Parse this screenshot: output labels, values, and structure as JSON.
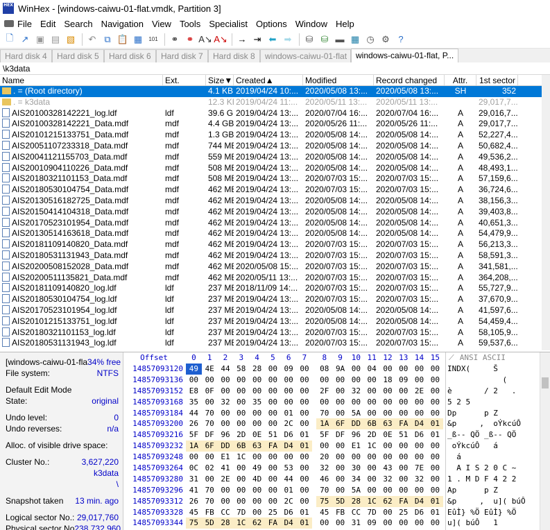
{
  "window": {
    "title": "WinHex - [windows-caiwu-01-flat.vmdk, Partition 3]",
    "icon_label": "HEX"
  },
  "menu": [
    "File",
    "Edit",
    "Search",
    "Navigation",
    "View",
    "Tools",
    "Specialist",
    "Options",
    "Window",
    "Help"
  ],
  "toolbar": {
    "icons": [
      "new-file-icon",
      "open-icon",
      "save-icon",
      "print-icon",
      "properties-icon",
      "undo-icon",
      "copy-icon",
      "paste-icon",
      "paste-hex-icon",
      "write-icon",
      "binoculars-icon",
      "find-hex-icon",
      "replace-icon",
      "replace-hex-icon",
      "goto-offset-icon",
      "goto-sector-icon",
      "back-icon",
      "forward-icon",
      "disk-icon",
      "open-disk-icon",
      "ram-icon",
      "calculator-icon",
      "clock-icon",
      "options-icon",
      "help-icon"
    ]
  },
  "tabs": [
    "Hard disk 4",
    "Hard disk 5",
    "Hard disk 6",
    "Hard disk 7",
    "Hard disk 8",
    "windows-caiwu-01-flat",
    "windows-caiwu-01-flat, P..."
  ],
  "path": "\\k3data",
  "columns": [
    "Name",
    "Ext.",
    "Size▼",
    "Created▲",
    "Modified",
    "Record changed",
    "Attr.",
    "1st sector"
  ],
  "files": [
    {
      "name": ". = (Root directory)",
      "ext": "",
      "size": "4.1 KB",
      "created": "2019/04/24 10:...",
      "modified": "2020/05/08 13:...",
      "rec": "2020/05/08 13:...",
      "attr": "SH",
      "sector": "352",
      "type": "folder",
      "style": "sel"
    },
    {
      "name": ". = k3data",
      "ext": "",
      "size": "12.3 KB",
      "created": "2019/04/24 11:...",
      "modified": "2020/05/11 13:...",
      "rec": "2020/05/11 13:...",
      "attr": "",
      "sector": "29,017,7...",
      "type": "folder",
      "style": "gray"
    },
    {
      "name": "AIS20100328142221_log.ldf",
      "ext": "ldf",
      "size": "39.6 GB",
      "created": "2019/04/24 13:...",
      "modified": "2020/07/04 16:...",
      "rec": "2020/07/04 16:...",
      "attr": "A",
      "sector": "29,016,7...",
      "type": "file",
      "style": ""
    },
    {
      "name": "AIS20100328142221_Data.mdf",
      "ext": "mdf",
      "size": "4.4 GB",
      "created": "2019/04/24 13:...",
      "modified": "2020/05/26 11:...",
      "rec": "2020/05/26 11:...",
      "attr": "A",
      "sector": "29,017,7...",
      "type": "file",
      "style": ""
    },
    {
      "name": "AIS20101215133751_Data.mdf",
      "ext": "mdf",
      "size": "1.3 GB",
      "created": "2019/04/24 13:...",
      "modified": "2020/05/08 14:...",
      "rec": "2020/05/08 14:...",
      "attr": "A",
      "sector": "52,227,4...",
      "type": "file",
      "style": ""
    },
    {
      "name": "AIS20051107233318_Data.mdf",
      "ext": "mdf",
      "size": "744 MB",
      "created": "2019/04/24 13:...",
      "modified": "2020/05/08 14:...",
      "rec": "2020/05/08 14:...",
      "attr": "A",
      "sector": "50,682,4...",
      "type": "file",
      "style": ""
    },
    {
      "name": "AIS20041121155703_Data.mdf",
      "ext": "mdf",
      "size": "559 MB",
      "created": "2019/04/24 13:...",
      "modified": "2020/05/08 14:...",
      "rec": "2020/05/08 14:...",
      "attr": "A",
      "sector": "49,536,2...",
      "type": "file",
      "style": ""
    },
    {
      "name": "AIS20010904110226_Data.mdf",
      "ext": "mdf",
      "size": "508 MB",
      "created": "2019/04/24 13:...",
      "modified": "2020/05/08 14:...",
      "rec": "2020/05/08 14:...",
      "attr": "A",
      "sector": "48,493,1...",
      "type": "file",
      "style": ""
    },
    {
      "name": "AIS20180321101153_Data.mdf",
      "ext": "mdf",
      "size": "508 MB",
      "created": "2019/04/24 13:...",
      "modified": "2020/07/03 15:...",
      "rec": "2020/07/03 15:...",
      "attr": "A",
      "sector": "57,159,6...",
      "type": "file",
      "style": ""
    },
    {
      "name": "AIS20180530104754_Data.mdf",
      "ext": "mdf",
      "size": "462 MB",
      "created": "2019/04/24 13:...",
      "modified": "2020/07/03 15:...",
      "rec": "2020/07/03 15:...",
      "attr": "A",
      "sector": "36,724,6...",
      "type": "file",
      "style": ""
    },
    {
      "name": "AIS20130516182725_Data.mdf",
      "ext": "mdf",
      "size": "462 MB",
      "created": "2019/04/24 13:...",
      "modified": "2020/05/08 14:...",
      "rec": "2020/05/08 14:...",
      "attr": "A",
      "sector": "38,156,3...",
      "type": "file",
      "style": ""
    },
    {
      "name": "AIS20150414104318_Data.mdf",
      "ext": "mdf",
      "size": "462 MB",
      "created": "2019/04/24 13:...",
      "modified": "2020/05/08 14:...",
      "rec": "2020/05/08 14:...",
      "attr": "A",
      "sector": "39,403,8...",
      "type": "file",
      "style": ""
    },
    {
      "name": "AIS20170523101954_Data.mdf",
      "ext": "mdf",
      "size": "462 MB",
      "created": "2019/04/24 13:...",
      "modified": "2020/05/08 14:...",
      "rec": "2020/05/08 14:...",
      "attr": "A",
      "sector": "40,651,3...",
      "type": "file",
      "style": ""
    },
    {
      "name": "AIS20130514163618_Data.mdf",
      "ext": "mdf",
      "size": "462 MB",
      "created": "2019/04/24 13:...",
      "modified": "2020/05/08 14:...",
      "rec": "2020/05/08 14:...",
      "attr": "A",
      "sector": "54,479,9...",
      "type": "file",
      "style": ""
    },
    {
      "name": "AIS20181109140820_Data.mdf",
      "ext": "mdf",
      "size": "462 MB",
      "created": "2019/04/24 13:...",
      "modified": "2020/07/03 15:...",
      "rec": "2020/07/03 15:...",
      "attr": "A",
      "sector": "56,213,3...",
      "type": "file",
      "style": ""
    },
    {
      "name": "AIS20180531131943_Data.mdf",
      "ext": "mdf",
      "size": "462 MB",
      "created": "2019/04/24 13:...",
      "modified": "2020/07/03 15:...",
      "rec": "2020/07/03 15:...",
      "attr": "A",
      "sector": "58,591,3...",
      "type": "file",
      "style": ""
    },
    {
      "name": "AIS20200508152028_Data.mdf",
      "ext": "mdf",
      "size": "462 MB",
      "created": "2020/05/08 15:...",
      "modified": "2020/07/03 15:...",
      "rec": "2020/07/03 15:...",
      "attr": "A",
      "sector": "341,581,...",
      "type": "file",
      "style": ""
    },
    {
      "name": "AIS20200511135821_Data.mdf",
      "ext": "mdf",
      "size": "462 MB",
      "created": "2020/05/11 13:...",
      "modified": "2020/07/03 15:...",
      "rec": "2020/07/03 15:...",
      "attr": "A",
      "sector": "364,208,...",
      "type": "file",
      "style": ""
    },
    {
      "name": "AIS20181109140820_log.ldf",
      "ext": "ldf",
      "size": "237 MB",
      "created": "2018/11/09 14:...",
      "modified": "2020/07/03 15:...",
      "rec": "2020/07/03 15:...",
      "attr": "A",
      "sector": "55,727,9...",
      "type": "file",
      "style": ""
    },
    {
      "name": "AIS20180530104754_log.ldf",
      "ext": "ldf",
      "size": "237 MB",
      "created": "2019/04/24 13:...",
      "modified": "2020/07/03 15:...",
      "rec": "2020/07/03 15:...",
      "attr": "A",
      "sector": "37,670,9...",
      "type": "file",
      "style": ""
    },
    {
      "name": "AIS20170523101954_log.ldf",
      "ext": "ldf",
      "size": "237 MB",
      "created": "2019/04/24 13:...",
      "modified": "2020/05/08 14:...",
      "rec": "2020/05/08 14:...",
      "attr": "A",
      "sector": "41,597,6...",
      "type": "file",
      "style": ""
    },
    {
      "name": "AIS20101215133751_log.ldf",
      "ext": "ldf",
      "size": "237 MB",
      "created": "2019/04/24 13:...",
      "modified": "2020/05/08 14:...",
      "rec": "2020/05/08 14:...",
      "attr": "A",
      "sector": "54,459,4...",
      "type": "file",
      "style": ""
    },
    {
      "name": "AIS20180321101153_log.ldf",
      "ext": "ldf",
      "size": "237 MB",
      "created": "2019/04/24 13:...",
      "modified": "2020/07/03 15:...",
      "rec": "2020/07/03 15:...",
      "attr": "A",
      "sector": "58,105,9...",
      "type": "file",
      "style": ""
    },
    {
      "name": "AIS20180531131943_log.ldf",
      "ext": "ldf",
      "size": "237 MB",
      "created": "2019/04/24 13:...",
      "modified": "2020/07/03 15:...",
      "rec": "2020/07/03 15:...",
      "attr": "A",
      "sector": "59,537,6...",
      "type": "file",
      "style": ""
    }
  ],
  "info": {
    "volume": "[windows-caiwu-01-fla",
    "free": "34% free",
    "fs_label": "File system:",
    "fs": "NTFS",
    "mode": "Default Edit Mode",
    "state_label": "State:",
    "state": "original",
    "undo_label": "Undo level:",
    "undo": "0",
    "undo_rev_label": "Undo reverses:",
    "undo_rev": "n/a",
    "alloc": "Alloc. of visible drive space:",
    "cluster_label": "Cluster No.:",
    "cluster": "3,627,220",
    "dir": "k3data",
    "dir2": "\\",
    "snap_label": "Snapshot taken",
    "snap": "13 min. ago",
    "log_label": "Logical sector No.:",
    "log": "29,017,760",
    "phys_label": "Physical sector No",
    "phys": "238,732,960"
  },
  "hex": {
    "offset_label": "Offset",
    "cols": [
      "0",
      "1",
      "2",
      "3",
      "4",
      "5",
      "6",
      "7",
      "8",
      "9",
      "10",
      "11",
      "12",
      "13",
      "14",
      "15"
    ],
    "ansi_label": "ANSI ASCII",
    "rows": [
      {
        "off": "14857093120",
        "b": [
          "49",
          "4E",
          "44",
          "58",
          "28",
          "00",
          "09",
          "00",
          "08",
          "9A",
          "00",
          "04",
          "00",
          "00",
          "00",
          "00"
        ],
        "hl": [],
        "cur": [
          0
        ],
        "ascii": "INDX(     Š"
      },
      {
        "off": "14857093136",
        "b": [
          "00",
          "00",
          "00",
          "00",
          "00",
          "00",
          "00",
          "00",
          "00",
          "00",
          "00",
          "00",
          "18",
          "09",
          "00",
          "00"
        ],
        "hl": [],
        "cur": [],
        "ascii": "            ("
      },
      {
        "off": "14857093152",
        "b": [
          "E8",
          "0F",
          "00",
          "00",
          "00",
          "00",
          "00",
          "00",
          "2F",
          "00",
          "32",
          "00",
          "00",
          "00",
          "2E",
          "00"
        ],
        "hl": [],
        "cur": [],
        "ascii": "è       / 2   ."
      },
      {
        "off": "14857093168",
        "b": [
          "35",
          "00",
          "32",
          "00",
          "35",
          "00",
          "00",
          "00",
          "00",
          "00",
          "00",
          "00",
          "00",
          "00",
          "00",
          "00"
        ],
        "hl": [],
        "cur": [],
        "ascii": "5 2 5"
      },
      {
        "off": "14857093184",
        "b": [
          "44",
          "70",
          "00",
          "00",
          "00",
          "00",
          "01",
          "00",
          "70",
          "00",
          "5A",
          "00",
          "00",
          "00",
          "00",
          "00"
        ],
        "hl": [],
        "cur": [],
        "ascii": "Dp      p Z"
      },
      {
        "off": "14857093200",
        "b": [
          "26",
          "70",
          "00",
          "00",
          "00",
          "00",
          "2C",
          "00",
          "1A",
          "6F",
          "DD",
          "6B",
          "63",
          "FA",
          "D4",
          "01"
        ],
        "hl": [
          8,
          9,
          10,
          11,
          12,
          13,
          14,
          15
        ],
        "cur": [],
        "ascii": "&p     ,  oÝkcúÔ"
      },
      {
        "off": "14857093216",
        "b": [
          "5F",
          "DF",
          "96",
          "2D",
          "0E",
          "51",
          "D6",
          "01",
          "5F",
          "DF",
          "96",
          "2D",
          "0E",
          "51",
          "D6",
          "01"
        ],
        "hl": [],
        "cur": [],
        "ascii": "_ß-- QÖ _ß-- QÖ"
      },
      {
        "off": "14857093232",
        "b": [
          "1A",
          "6F",
          "DD",
          "6B",
          "63",
          "FA",
          "D4",
          "01",
          "00",
          "00",
          "E1",
          "1C",
          "00",
          "00",
          "00",
          "00"
        ],
        "hl": [
          0,
          1,
          2,
          3,
          4,
          5,
          6,
          7
        ],
        "cur": [],
        "ascii": " oÝkcúÔ   á"
      },
      {
        "off": "14857093248",
        "b": [
          "00",
          "00",
          "E1",
          "1C",
          "00",
          "00",
          "00",
          "00",
          "20",
          "00",
          "00",
          "00",
          "00",
          "00",
          "00",
          "00"
        ],
        "hl": [],
        "cur": [],
        "ascii": "  á"
      },
      {
        "off": "14857093264",
        "b": [
          "0C",
          "02",
          "41",
          "00",
          "49",
          "00",
          "53",
          "00",
          "32",
          "00",
          "30",
          "00",
          "43",
          "00",
          "7E",
          "00"
        ],
        "hl": [],
        "cur": [],
        "ascii": "  A I S 2 0 C ~"
      },
      {
        "off": "14857093280",
        "b": [
          "31",
          "00",
          "2E",
          "00",
          "4D",
          "00",
          "44",
          "00",
          "46",
          "00",
          "34",
          "00",
          "32",
          "00",
          "32",
          "00"
        ],
        "hl": [],
        "cur": [],
        "ascii": "1 . M D F 4 2 2"
      },
      {
        "off": "14857093296",
        "b": [
          "41",
          "70",
          "00",
          "00",
          "00",
          "00",
          "01",
          "00",
          "70",
          "00",
          "5A",
          "00",
          "00",
          "00",
          "00",
          "00"
        ],
        "hl": [],
        "cur": [],
        "ascii": "Ap      p Z"
      },
      {
        "off": "14857093312",
        "b": [
          "26",
          "70",
          "00",
          "00",
          "00",
          "00",
          "2C",
          "00",
          "75",
          "5D",
          "28",
          "1C",
          "62",
          "FA",
          "D4",
          "01"
        ],
        "hl": [
          8,
          9,
          10,
          11,
          12,
          13,
          14,
          15
        ],
        "cur": [],
        "ascii": "&p     ,  u]( búÔ"
      },
      {
        "off": "14857093328",
        "b": [
          "45",
          "FB",
          "CC",
          "7D",
          "00",
          "25",
          "D6",
          "01",
          "45",
          "FB",
          "CC",
          "7D",
          "00",
          "25",
          "D6",
          "01"
        ],
        "hl": [],
        "cur": [],
        "ascii": "EûÌ} %Ö EûÌ} %Ö"
      },
      {
        "off": "14857093344",
        "b": [
          "75",
          "5D",
          "28",
          "1C",
          "62",
          "FA",
          "D4",
          "01",
          "00",
          "00",
          "31",
          "09",
          "00",
          "00",
          "00",
          "00"
        ],
        "hl": [
          0,
          1,
          2,
          3,
          4,
          5,
          6,
          7
        ],
        "cur": [],
        "ascii": "u]( búÔ   1"
      }
    ]
  }
}
